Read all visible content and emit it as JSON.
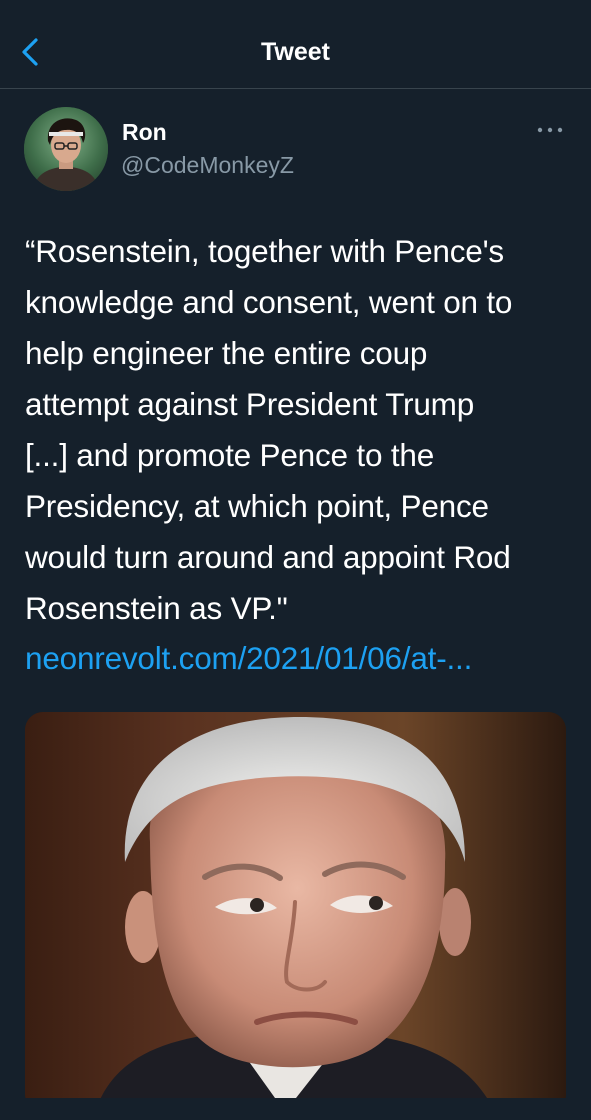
{
  "header": {
    "title": "Tweet",
    "back_icon": "chevron-left-icon"
  },
  "author": {
    "name": "Ron",
    "handle": "@CodeMonkeyZ",
    "more_icon": "more-horizontal-icon"
  },
  "tweet": {
    "lines": [
      "“Rosenstein, together with Pence's",
      "knowledge and consent, went on to",
      "help engineer the entire coup",
      "attempt against President Trump",
      "[...] and promote Pence to the",
      "Presidency, at which point, Pence",
      "would turn around and appoint Rod",
      "Rosenstein as VP.\""
    ],
    "link": "neonrevolt.com/2021/01/06/at-..."
  },
  "colors": {
    "background": "#15202b",
    "link": "#1da1f2",
    "accent": "#1da1f2",
    "secondary_text": "#8899a6",
    "divider": "#38444d"
  }
}
